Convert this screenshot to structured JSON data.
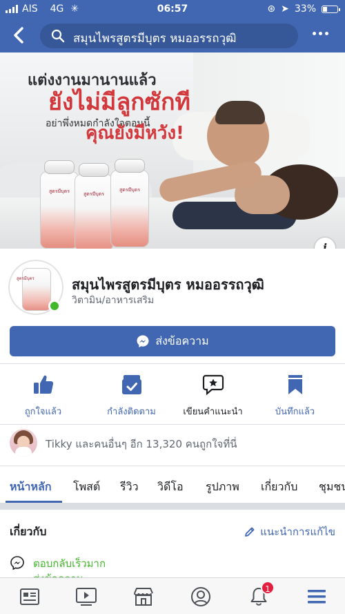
{
  "status_bar": {
    "carrier": "AIS",
    "network": "4G",
    "time": "06:57",
    "battery": "33%",
    "battery_level": 0.33
  },
  "header": {
    "search_text": "สมุนไพรสูตรมีบุตร หมออรรถวุฒิ",
    "icons": [
      "back-arrow-icon",
      "search-icon",
      "more-dots-icon"
    ]
  },
  "cover": {
    "line1": "แต่งงานมานานแล้ว",
    "line2": "ยังไม่มีลูกซักที",
    "line3": "อย่าพึ่งหมดกำลังใจตอนนี้",
    "line4": "คุณยังมีหวัง!",
    "bottle_label": "สูตรมีบุตร",
    "info_label": "i"
  },
  "profile": {
    "name": "สมุนไพรสูตรมีบุตร หมออรรถวุฒิ",
    "category": "วิตามิน/อาหารเสริม",
    "message_button": "ส่งข้อความ"
  },
  "actions": [
    {
      "label": "ถูกใจแล้ว",
      "icon": "thumbs-up-icon"
    },
    {
      "label": "กำลังติดตาม",
      "icon": "following-check-icon"
    },
    {
      "label": "เขียนคำแนะนำ",
      "icon": "recommend-star-icon"
    },
    {
      "label": "บันทึกแล้ว",
      "icon": "bookmark-icon"
    }
  ],
  "likes": {
    "text": "Tikky และคนอื่นๆ อีก 13,320 คนถูกใจที่นี่"
  },
  "tabs": [
    "หน้าหลัก",
    "โพสต์",
    "รีวิว",
    "วิดีโอ",
    "รูปภาพ",
    "เกี่ยวกับ",
    "ชุมชน"
  ],
  "about": {
    "title": "เกี่ยวกับ",
    "edit_label": "แนะนำการแก้ไข",
    "response_line1": "ตอบกลับเร็วมาก",
    "response_line2": "ส่งข้อความ"
  },
  "bottom_nav": {
    "items": [
      "news-feed-icon",
      "watch-video-icon",
      "marketplace-icon",
      "profile-icon",
      "notifications-bell-icon",
      "menu-icon"
    ],
    "notification_count": "1"
  },
  "colors": {
    "brand_blue": "#4267b2",
    "online_green": "#42b72a",
    "badge_red": "#e41e3f",
    "cover_red": "#d2373b"
  }
}
